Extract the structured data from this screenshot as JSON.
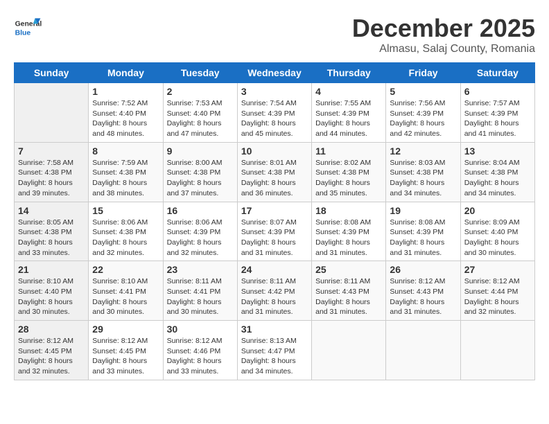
{
  "header": {
    "logo_general": "General",
    "logo_blue": "Blue",
    "month_title": "December 2025",
    "subtitle": "Almasu, Salaj County, Romania"
  },
  "calendar": {
    "weekdays": [
      "Sunday",
      "Monday",
      "Tuesday",
      "Wednesday",
      "Thursday",
      "Friday",
      "Saturday"
    ],
    "weeks": [
      [
        {
          "day": "",
          "sunrise": "",
          "sunset": "",
          "daylight": ""
        },
        {
          "day": "1",
          "sunrise": "Sunrise: 7:52 AM",
          "sunset": "Sunset: 4:40 PM",
          "daylight": "Daylight: 8 hours and 48 minutes."
        },
        {
          "day": "2",
          "sunrise": "Sunrise: 7:53 AM",
          "sunset": "Sunset: 4:40 PM",
          "daylight": "Daylight: 8 hours and 47 minutes."
        },
        {
          "day": "3",
          "sunrise": "Sunrise: 7:54 AM",
          "sunset": "Sunset: 4:39 PM",
          "daylight": "Daylight: 8 hours and 45 minutes."
        },
        {
          "day": "4",
          "sunrise": "Sunrise: 7:55 AM",
          "sunset": "Sunset: 4:39 PM",
          "daylight": "Daylight: 8 hours and 44 minutes."
        },
        {
          "day": "5",
          "sunrise": "Sunrise: 7:56 AM",
          "sunset": "Sunset: 4:39 PM",
          "daylight": "Daylight: 8 hours and 42 minutes."
        },
        {
          "day": "6",
          "sunrise": "Sunrise: 7:57 AM",
          "sunset": "Sunset: 4:39 PM",
          "daylight": "Daylight: 8 hours and 41 minutes."
        }
      ],
      [
        {
          "day": "7",
          "sunrise": "Sunrise: 7:58 AM",
          "sunset": "Sunset: 4:38 PM",
          "daylight": "Daylight: 8 hours and 39 minutes."
        },
        {
          "day": "8",
          "sunrise": "Sunrise: 7:59 AM",
          "sunset": "Sunset: 4:38 PM",
          "daylight": "Daylight: 8 hours and 38 minutes."
        },
        {
          "day": "9",
          "sunrise": "Sunrise: 8:00 AM",
          "sunset": "Sunset: 4:38 PM",
          "daylight": "Daylight: 8 hours and 37 minutes."
        },
        {
          "day": "10",
          "sunrise": "Sunrise: 8:01 AM",
          "sunset": "Sunset: 4:38 PM",
          "daylight": "Daylight: 8 hours and 36 minutes."
        },
        {
          "day": "11",
          "sunrise": "Sunrise: 8:02 AM",
          "sunset": "Sunset: 4:38 PM",
          "daylight": "Daylight: 8 hours and 35 minutes."
        },
        {
          "day": "12",
          "sunrise": "Sunrise: 8:03 AM",
          "sunset": "Sunset: 4:38 PM",
          "daylight": "Daylight: 8 hours and 34 minutes."
        },
        {
          "day": "13",
          "sunrise": "Sunrise: 8:04 AM",
          "sunset": "Sunset: 4:38 PM",
          "daylight": "Daylight: 8 hours and 34 minutes."
        }
      ],
      [
        {
          "day": "14",
          "sunrise": "Sunrise: 8:05 AM",
          "sunset": "Sunset: 4:38 PM",
          "daylight": "Daylight: 8 hours and 33 minutes."
        },
        {
          "day": "15",
          "sunrise": "Sunrise: 8:06 AM",
          "sunset": "Sunset: 4:38 PM",
          "daylight": "Daylight: 8 hours and 32 minutes."
        },
        {
          "day": "16",
          "sunrise": "Sunrise: 8:06 AM",
          "sunset": "Sunset: 4:39 PM",
          "daylight": "Daylight: 8 hours and 32 minutes."
        },
        {
          "day": "17",
          "sunrise": "Sunrise: 8:07 AM",
          "sunset": "Sunset: 4:39 PM",
          "daylight": "Daylight: 8 hours and 31 minutes."
        },
        {
          "day": "18",
          "sunrise": "Sunrise: 8:08 AM",
          "sunset": "Sunset: 4:39 PM",
          "daylight": "Daylight: 8 hours and 31 minutes."
        },
        {
          "day": "19",
          "sunrise": "Sunrise: 8:08 AM",
          "sunset": "Sunset: 4:39 PM",
          "daylight": "Daylight: 8 hours and 31 minutes."
        },
        {
          "day": "20",
          "sunrise": "Sunrise: 8:09 AM",
          "sunset": "Sunset: 4:40 PM",
          "daylight": "Daylight: 8 hours and 30 minutes."
        }
      ],
      [
        {
          "day": "21",
          "sunrise": "Sunrise: 8:10 AM",
          "sunset": "Sunset: 4:40 PM",
          "daylight": "Daylight: 8 hours and 30 minutes."
        },
        {
          "day": "22",
          "sunrise": "Sunrise: 8:10 AM",
          "sunset": "Sunset: 4:41 PM",
          "daylight": "Daylight: 8 hours and 30 minutes."
        },
        {
          "day": "23",
          "sunrise": "Sunrise: 8:11 AM",
          "sunset": "Sunset: 4:41 PM",
          "daylight": "Daylight: 8 hours and 30 minutes."
        },
        {
          "day": "24",
          "sunrise": "Sunrise: 8:11 AM",
          "sunset": "Sunset: 4:42 PM",
          "daylight": "Daylight: 8 hours and 31 minutes."
        },
        {
          "day": "25",
          "sunrise": "Sunrise: 8:11 AM",
          "sunset": "Sunset: 4:43 PM",
          "daylight": "Daylight: 8 hours and 31 minutes."
        },
        {
          "day": "26",
          "sunrise": "Sunrise: 8:12 AM",
          "sunset": "Sunset: 4:43 PM",
          "daylight": "Daylight: 8 hours and 31 minutes."
        },
        {
          "day": "27",
          "sunrise": "Sunrise: 8:12 AM",
          "sunset": "Sunset: 4:44 PM",
          "daylight": "Daylight: 8 hours and 32 minutes."
        }
      ],
      [
        {
          "day": "28",
          "sunrise": "Sunrise: 8:12 AM",
          "sunset": "Sunset: 4:45 PM",
          "daylight": "Daylight: 8 hours and 32 minutes."
        },
        {
          "day": "29",
          "sunrise": "Sunrise: 8:12 AM",
          "sunset": "Sunset: 4:45 PM",
          "daylight": "Daylight: 8 hours and 33 minutes."
        },
        {
          "day": "30",
          "sunrise": "Sunrise: 8:12 AM",
          "sunset": "Sunset: 4:46 PM",
          "daylight": "Daylight: 8 hours and 33 minutes."
        },
        {
          "day": "31",
          "sunrise": "Sunrise: 8:13 AM",
          "sunset": "Sunset: 4:47 PM",
          "daylight": "Daylight: 8 hours and 34 minutes."
        },
        {
          "day": "",
          "sunrise": "",
          "sunset": "",
          "daylight": ""
        },
        {
          "day": "",
          "sunrise": "",
          "sunset": "",
          "daylight": ""
        },
        {
          "day": "",
          "sunrise": "",
          "sunset": "",
          "daylight": ""
        }
      ]
    ]
  }
}
